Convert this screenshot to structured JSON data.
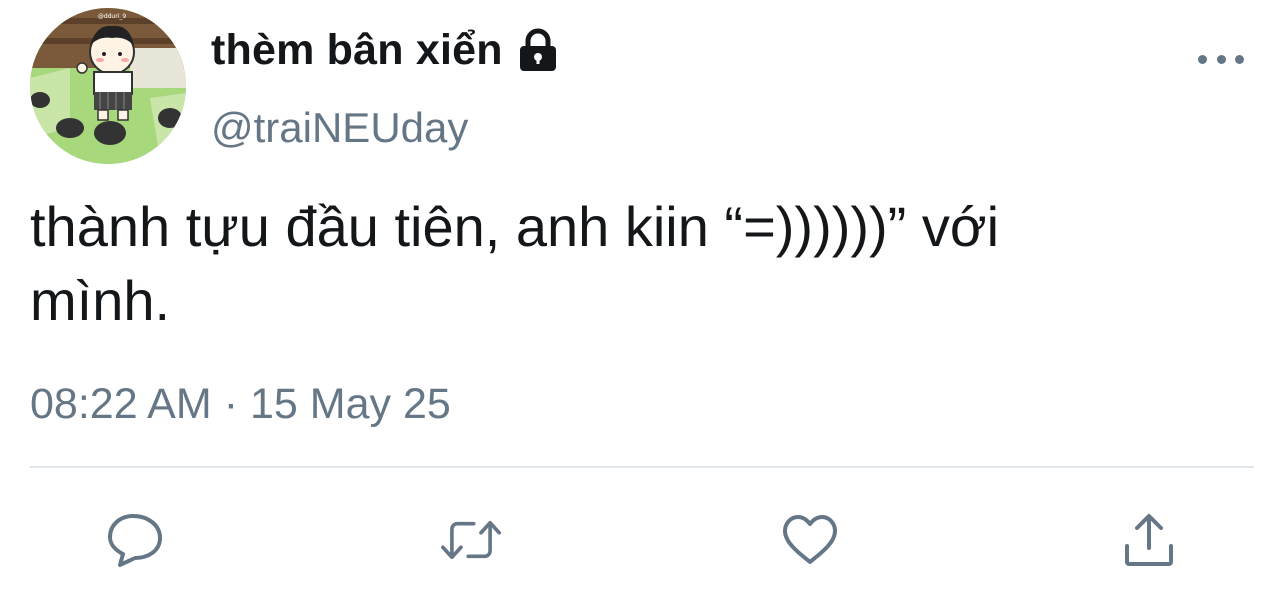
{
  "author": {
    "display_name": "thèm bân xiển",
    "handle": "@traiNEUday",
    "avatar_label": "@dduri_9"
  },
  "tweet": {
    "text": "thành tựu đầu tiên, anh kiin “=))))))” với\nmình.",
    "time": "08:22 AM",
    "separator": "·",
    "date": "15 May 25"
  },
  "icons": {
    "lock": "lock-icon",
    "more": "more-dots-icon",
    "reply": "reply-bubble-icon",
    "retweet": "retweet-icon",
    "like": "heart-icon",
    "share": "share-upload-icon"
  },
  "colors": {
    "text": "#14171a",
    "secondary": "#657786",
    "divider": "#e1e8ed"
  }
}
